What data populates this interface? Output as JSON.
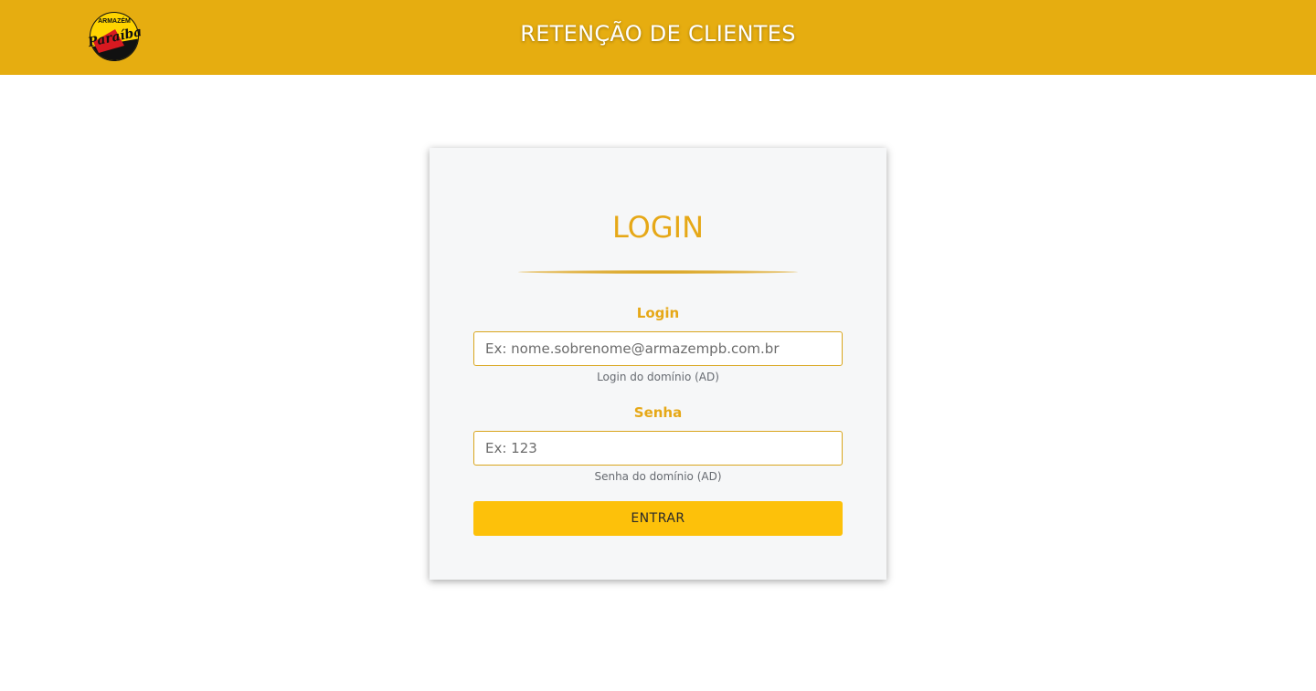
{
  "header": {
    "app_title": "RETENÇÃO DE CLIENTES",
    "logo": {
      "top_text": "ARMAZÉM",
      "script_text": "Paraíba",
      "colors": {
        "yellow": "#ffd400",
        "red": "#d71920",
        "black": "#111111"
      }
    }
  },
  "login_card": {
    "title": "LOGIN",
    "login_field": {
      "label": "Login",
      "placeholder": "Ex: nome.sobrenome@armazempb.com.br",
      "value": "",
      "hint": "Login do domínio (AD)"
    },
    "password_field": {
      "label": "Senha",
      "placeholder": "Ex: 123",
      "value": "",
      "hint": "Senha do domínio (AD)"
    },
    "submit_label": "ENTRAR"
  },
  "colors": {
    "header_bg": "#e6ad10",
    "accent": "#e6a817",
    "button_bg": "#fdc10a",
    "card_bg": "#f6f7f8"
  }
}
